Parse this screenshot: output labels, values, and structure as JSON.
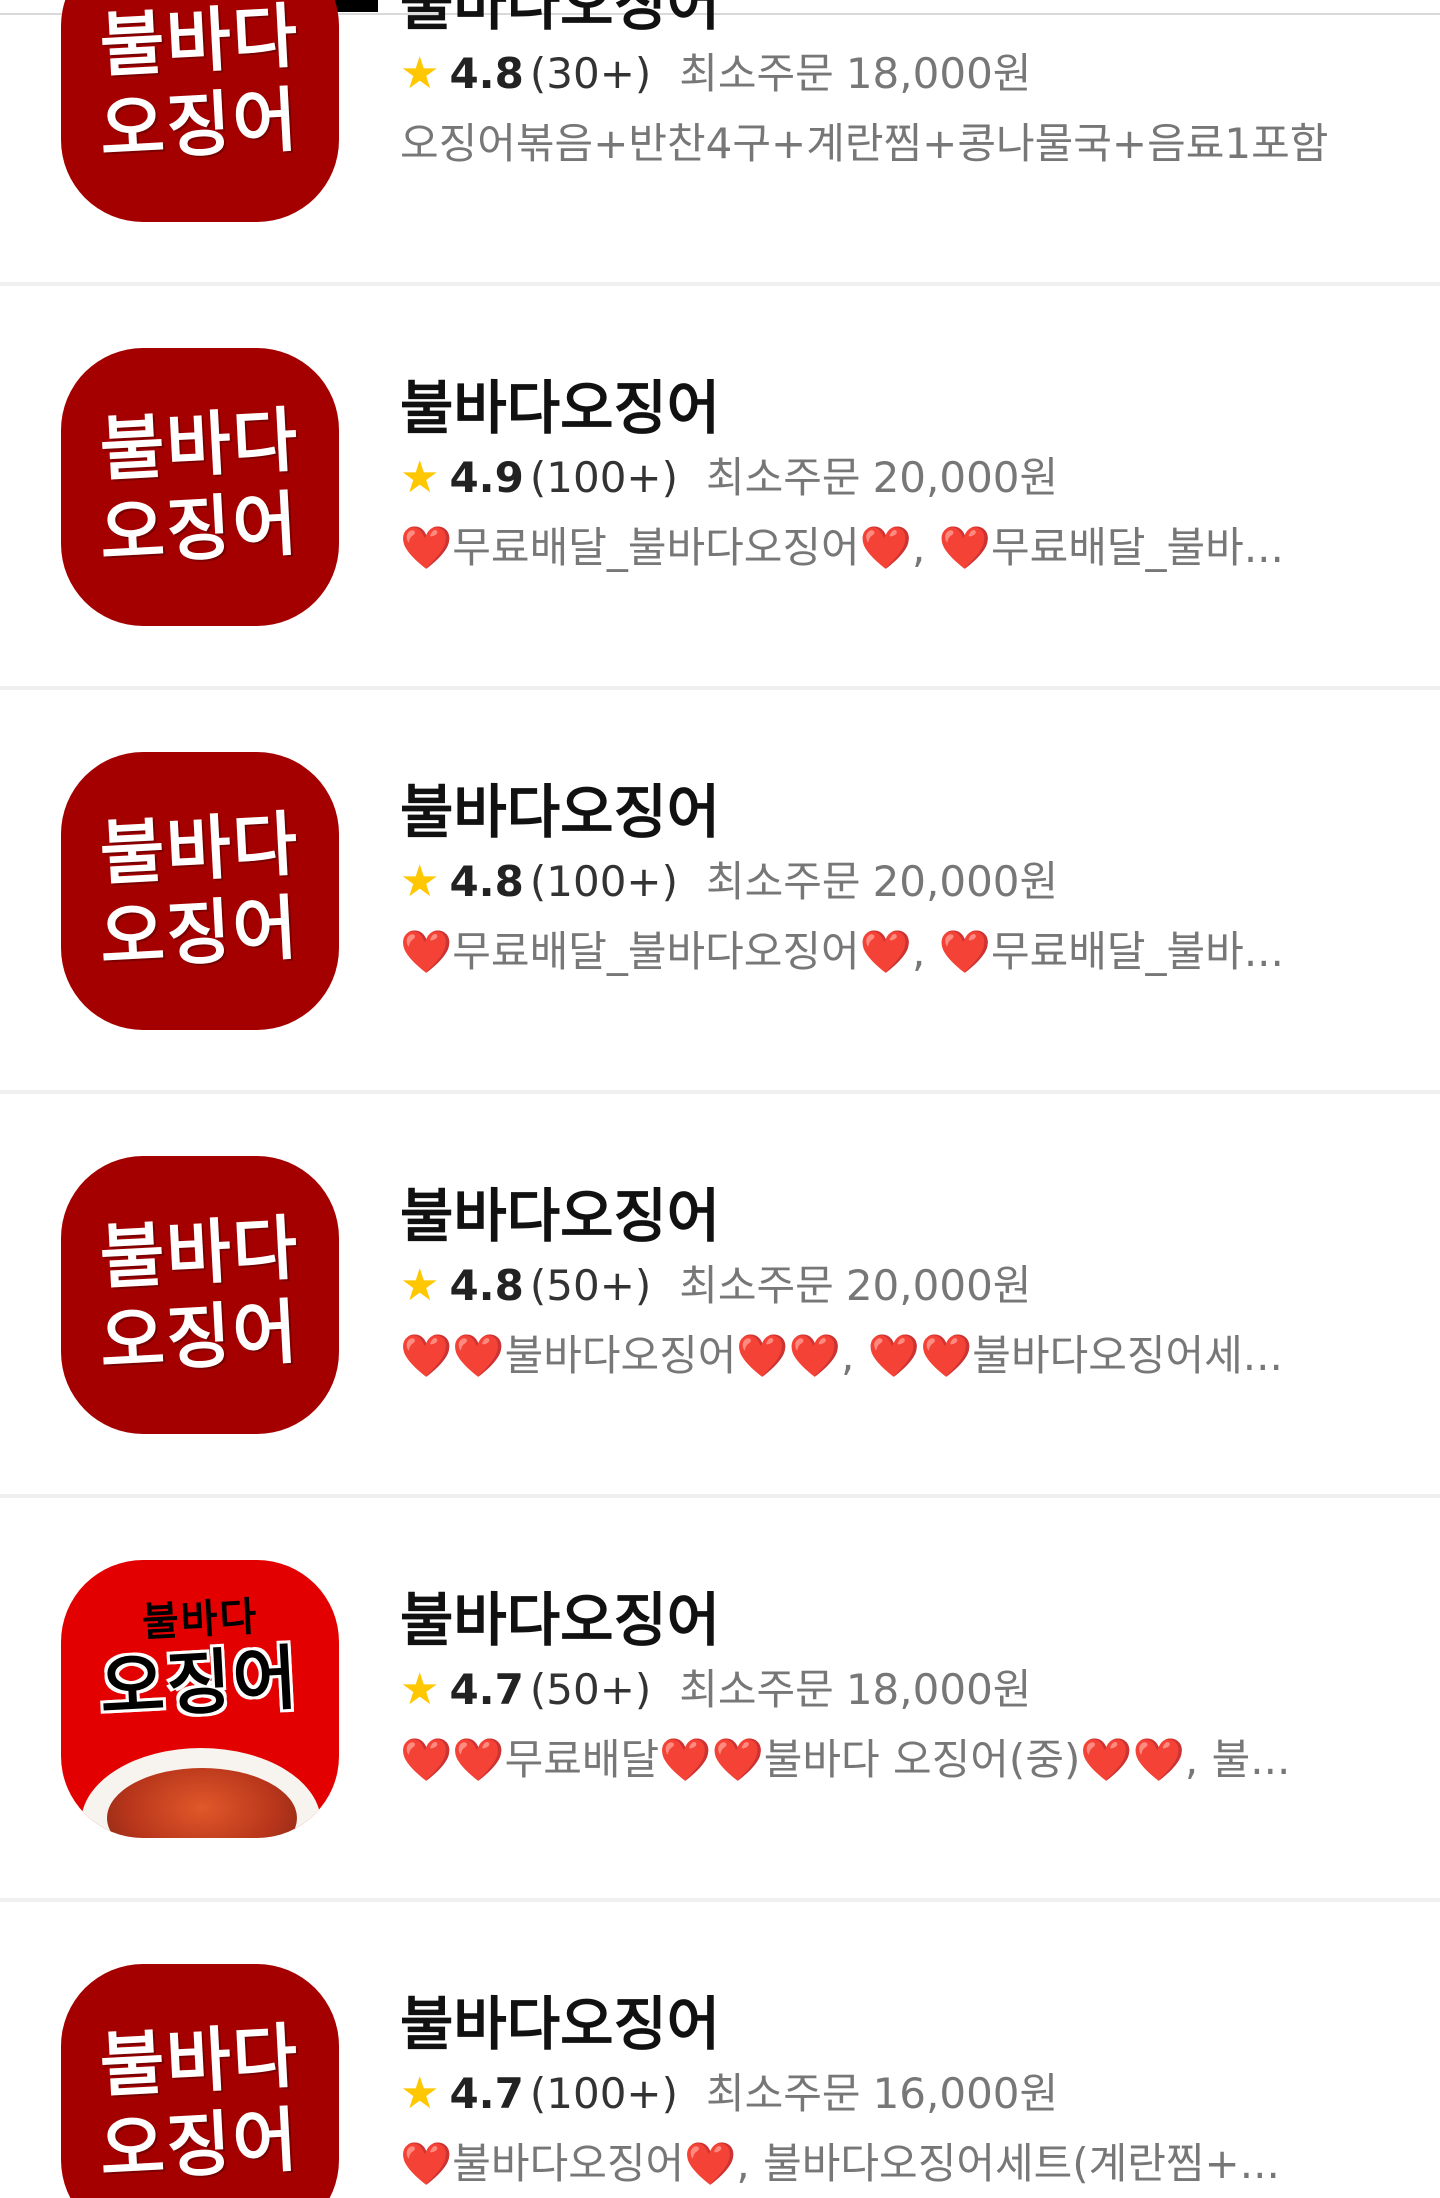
{
  "colors": {
    "star": "#ffc700",
    "logo_dark": "#a50000",
    "logo_bright": "#e30000"
  },
  "stores": [
    {
      "name": "불바다오징어",
      "logo_line1": "불바다",
      "logo_line2": "오징어",
      "star_icon": "★",
      "rating": "4.8",
      "reviews": "(30+)",
      "min_label": "최소주문",
      "min_value": "18,000원",
      "menu": "오징어볶음+반찬4구+계란찜+콩나물국+음료1포함"
    },
    {
      "name": "불바다오징어",
      "logo_line1": "불바다",
      "logo_line2": "오징어",
      "star_icon": "★",
      "rating": "4.9",
      "reviews": "(100+)",
      "min_label": "최소주문",
      "min_value": "20,000원",
      "menu": "❤️무료배달_불바다오징어❤️, ❤️무료배달_불바..."
    },
    {
      "name": "불바다오징어",
      "logo_line1": "불바다",
      "logo_line2": "오징어",
      "star_icon": "★",
      "rating": "4.8",
      "reviews": "(100+)",
      "min_label": "최소주문",
      "min_value": "20,000원",
      "menu": "❤️무료배달_불바다오징어❤️, ❤️무료배달_불바..."
    },
    {
      "name": "불바다오징어",
      "logo_line1": "불바다",
      "logo_line2": "오징어",
      "star_icon": "★",
      "rating": "4.8",
      "reviews": "(50+)",
      "min_label": "최소주문",
      "min_value": "20,000원",
      "menu": "❤️❤️불바다오징어❤️❤️, ❤️❤️불바다오징어세..."
    },
    {
      "name": "불바다오징어",
      "logo_line1": "불바다",
      "logo_line2": "오징어",
      "star_icon": "★",
      "rating": "4.7",
      "reviews": "(50+)",
      "min_label": "최소주문",
      "min_value": "18,000원",
      "menu": "❤️❤️무료배달❤️❤️불바다 오징어(중)❤️❤️, 불..."
    },
    {
      "name": "불바다오징어",
      "logo_line1": "불바다",
      "logo_line2": "오징어",
      "star_icon": "★",
      "rating": "4.7",
      "reviews": "(100+)",
      "min_label": "최소주문",
      "min_value": "16,000원",
      "menu": "❤️불바다오징어❤️, 불바다오징어세트(계란찜+..."
    }
  ]
}
